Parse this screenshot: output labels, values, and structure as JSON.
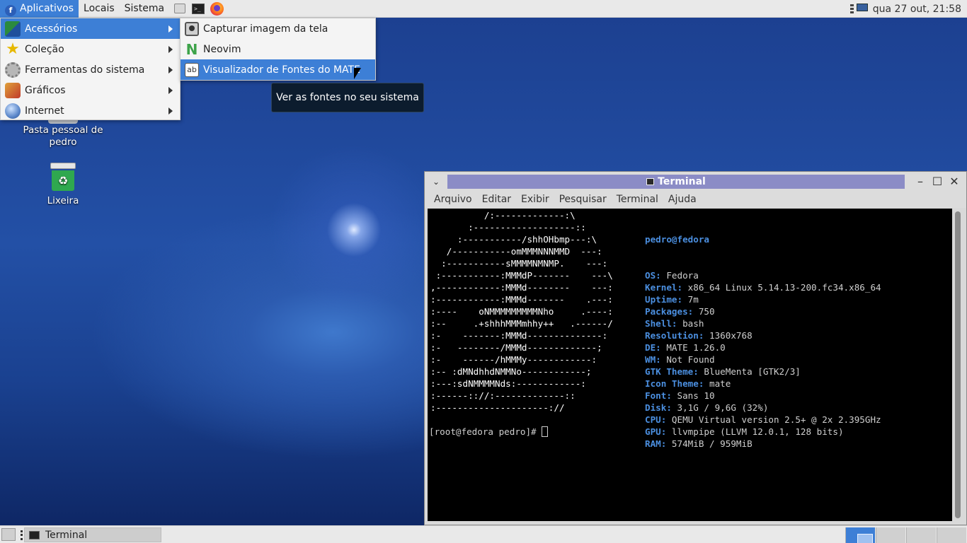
{
  "top_panel": {
    "applications": "Aplicativos",
    "places": "Locais",
    "system": "Sistema",
    "clock": "qua 27 out, 21:58"
  },
  "main_menu": {
    "items": [
      {
        "label": "Acessórios",
        "icon": "accessories-icon"
      },
      {
        "label": "Coleção",
        "icon": "star-icon"
      },
      {
        "label": "Ferramentas do sistema",
        "icon": "gear-icon"
      },
      {
        "label": "Gráficos",
        "icon": "graphics-icon"
      },
      {
        "label": "Internet",
        "icon": "globe-icon"
      }
    ]
  },
  "sub_menu": {
    "items": [
      {
        "label": "Capturar imagem da tela",
        "icon": "screenshot-icon"
      },
      {
        "label": "Neovim",
        "icon": "neovim-icon"
      },
      {
        "label": "Visualizador de Fontes do MATE",
        "icon": "font-viewer-icon"
      }
    ]
  },
  "tooltip": "Ver as fontes no seu sistema",
  "desktop": {
    "home_label": "Pasta pessoal de pedro",
    "trash_label": "Lixeira"
  },
  "terminal": {
    "title": "Terminal",
    "menu": [
      "Arquivo",
      "Editar",
      "Exibir",
      "Pesquisar",
      "Terminal",
      "Ajuda"
    ],
    "neofetch": {
      "user_host": "pedro@fedora",
      "fields": [
        {
          "key": "OS",
          "value": "Fedora"
        },
        {
          "key": "Kernel",
          "value": "x86_64 Linux 5.14.13-200.fc34.x86_64"
        },
        {
          "key": "Uptime",
          "value": "7m"
        },
        {
          "key": "Packages",
          "value": "750"
        },
        {
          "key": "Shell",
          "value": "bash"
        },
        {
          "key": "Resolution",
          "value": "1360x768"
        },
        {
          "key": "DE",
          "value": "MATE 1.26.0"
        },
        {
          "key": "WM",
          "value": "Not Found"
        },
        {
          "key": "GTK Theme",
          "value": "BlueMenta [GTK2/3]"
        },
        {
          "key": "Icon Theme",
          "value": "mate"
        },
        {
          "key": "Font",
          "value": "Sans 10"
        },
        {
          "key": "Disk",
          "value": "3,1G / 9,6G (32%)"
        },
        {
          "key": "CPU",
          "value": "QEMU Virtual version 2.5+ @ 2x 2.395GHz"
        },
        {
          "key": "GPU",
          "value": "llvmpipe (LLVM 12.0.1, 128 bits)"
        },
        {
          "key": "RAM",
          "value": "574MiB / 959MiB"
        }
      ]
    },
    "logo_lines": [
      "          /:-------------:\\",
      "       :-------------------::",
      "     :-----------/shhOHbmp---:\\",
      "   /-----------omMMMNNNMMD  ---:",
      "  :-----------sMMMMNMNMP.    ---:",
      " :-----------:MMMdP-------    ---\\",
      ",------------:MMMd--------    ---:",
      ":------------:MMMd-------    .---:",
      ":----    oNMMMMMMMMMNho     .----:",
      ":--     .+shhhMMMmhhy++   .------/",
      ":-    -------:MMMd--------------:",
      ":-   --------/MMMd-------------;",
      ":-    ------/hMMMy------------:",
      ":-- :dMNdhhdNMMNo------------;",
      ":---:sdNMMMMNds:------------:",
      ":------:://:-------------::",
      ":---------------------://"
    ],
    "prompt": "[root@fedora pedro]# "
  },
  "bottom_panel": {
    "task_label": "Terminal",
    "active_workspace": 1,
    "workspace_count": 4
  }
}
